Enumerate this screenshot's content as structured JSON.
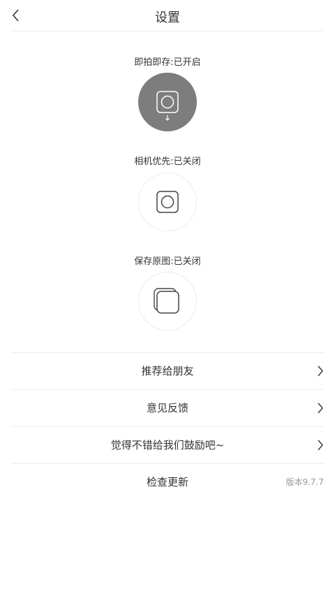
{
  "header": {
    "title": "设置",
    "back_icon": "chevron-left-icon"
  },
  "toggles": [
    {
      "label": "即拍即存:已开启",
      "state": "on",
      "icon": "instant-save-icon"
    },
    {
      "label": "相机优先:已关闭",
      "state": "off",
      "icon": "camera-frame-icon"
    },
    {
      "label": "保存原图:已关闭",
      "state": "off",
      "icon": "stacked-photos-icon"
    }
  ],
  "menu": [
    {
      "label": "推荐给朋友",
      "trailing_icon": "chevron-right-icon"
    },
    {
      "label": "意见反馈",
      "trailing_icon": "chevron-right-icon"
    },
    {
      "label": "觉得不错给我们鼓励吧~",
      "trailing_icon": "chevron-right-icon"
    },
    {
      "label": "检查更新",
      "version": "版本9.7.7"
    }
  ],
  "colors": {
    "active_toggle": "#7d7d7d",
    "divider": "#eeeeee",
    "muted_text": "#999999"
  }
}
